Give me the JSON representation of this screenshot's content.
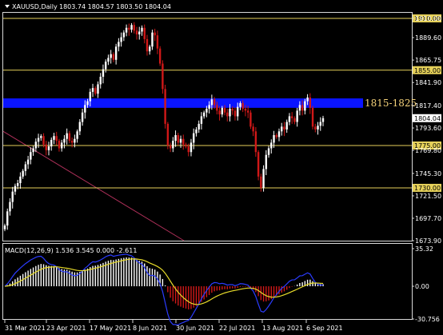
{
  "header": {
    "symbol_timeframe": "XAUUSD,Daily",
    "ohlc": "1803.74 1804.57 1803.50 1804.04"
  },
  "macd_header": "MACD(12,26,9) 1.536 3.545 0.000 -2.611",
  "colors": {
    "background": "#000000",
    "bull": "#ffffff",
    "bear": "#d01818",
    "level_line": "#e6d15a",
    "zone": "#0a14ff",
    "trendline": "#b0305a",
    "macd_signal": "#e8dc2a",
    "macd_main": "#2b3cff"
  },
  "chart_data": [
    {
      "type": "candlestick",
      "title": "XAUUSD,Daily",
      "y_ticks": [
        "1910.00",
        "1889.60",
        "1865.75",
        "1841.90",
        "1817.40",
        "1793.60",
        "1769.80",
        "1745.30",
        "1721.50",
        "1697.70",
        "1673.90"
      ],
      "ylim": [
        1673.9,
        1910.0
      ],
      "x_ticks": [
        "31 Mar 2021",
        "23 Apr 2021",
        "17 May 2021",
        "8 Jun 2021",
        "30 Jun 2021",
        "22 Jul 2021",
        "13 Aug 2021",
        "6 Sep 2021"
      ],
      "current_price": "1804.04",
      "horizontal_levels": [
        {
          "value": 1910.0,
          "label": "1910.00"
        },
        {
          "value": 1855.0,
          "label": "1855.00"
        },
        {
          "value": 1775.0,
          "label": "1775.00"
        },
        {
          "value": 1730.0,
          "label": "1730.00"
        }
      ],
      "zone": {
        "from": 1815,
        "to": 1825,
        "label": "1815-1825"
      },
      "trendline": {
        "from": {
          "x": "start",
          "y": 1790
        },
        "to": {
          "x": "8 Jun 2021",
          "y": 1673.9
        }
      },
      "close_path": [
        1690,
        1705,
        1715,
        1726,
        1732,
        1735,
        1742,
        1748,
        1755,
        1760,
        1768,
        1772,
        1779,
        1783,
        1785,
        1776,
        1770,
        1774,
        1781,
        1785,
        1780,
        1772,
        1778,
        1782,
        1788,
        1780,
        1778,
        1782,
        1790,
        1800,
        1810,
        1818,
        1822,
        1832,
        1836,
        1830,
        1840,
        1848,
        1856,
        1864,
        1868,
        1872,
        1866,
        1880,
        1885,
        1890,
        1895,
        1900,
        1898,
        1903,
        1897,
        1893,
        1896,
        1900,
        1888,
        1875,
        1880,
        1895,
        1892,
        1878,
        1862,
        1835,
        1798,
        1775,
        1772,
        1780,
        1786,
        1778,
        1782,
        1776,
        1774,
        1768,
        1778,
        1788,
        1792,
        1798,
        1806,
        1810,
        1814,
        1818,
        1824,
        1818,
        1812,
        1808,
        1815,
        1810,
        1806,
        1814,
        1812,
        1806,
        1816,
        1820,
        1814,
        1812,
        1810,
        1795,
        1790,
        1768,
        1742,
        1730,
        1750,
        1765,
        1772,
        1778,
        1786,
        1784,
        1790,
        1795,
        1792,
        1800,
        1806,
        1804,
        1800,
        1812,
        1818,
        1812,
        1822,
        1826,
        1815,
        1795,
        1792,
        1796,
        1800,
        1804
      ]
    },
    {
      "type": "macd",
      "title": "MACD(12,26,9) 1.536 3.545 0.000 -2.611",
      "y_ticks": [
        "35.32",
        "0.00",
        "-30.756"
      ],
      "ylim": [
        -30.756,
        35.32
      ],
      "values": {
        "main": 1.536,
        "signal": 3.545,
        "histogram": 0.0,
        "extra": -2.611
      }
    }
  ]
}
